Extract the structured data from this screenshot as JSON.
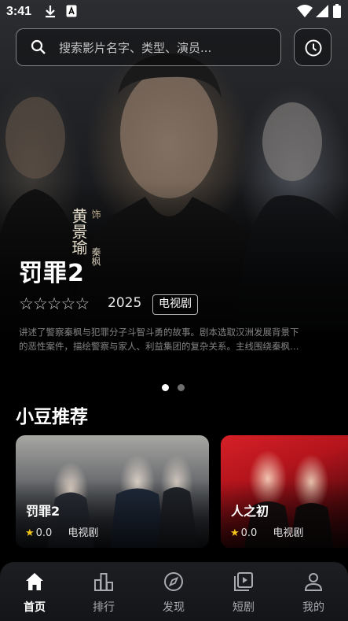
{
  "status_bar": {
    "time": "3:41"
  },
  "search": {
    "placeholder": "搜索影片名字、类型、演员..."
  },
  "hero": {
    "poster_name": "黄景瑜",
    "poster_role_suffix": "饰",
    "poster_role": "秦枫",
    "title": "罚罪2",
    "rating_stars": 0,
    "year": "2025",
    "type": "电视剧",
    "description_line1": "讲述了警察秦枫与犯罪分子斗智斗勇的故事。剧本选取汉洲发展背景下",
    "description_line2": "的恶性案件，描绘警察与家人、利益集团的复杂关系。主线围绕秦枫…",
    "carousel_count": 2,
    "carousel_active": 0
  },
  "recommend": {
    "title": "小豆推荐",
    "items": [
      {
        "title": "罚罪2",
        "score": "0.0",
        "type": "电视剧"
      },
      {
        "title": "人之初",
        "score": "0.0",
        "type": "电视剧"
      }
    ]
  },
  "nav": {
    "items": [
      {
        "label": "首页",
        "icon": "home-icon",
        "active": true
      },
      {
        "label": "排行",
        "icon": "bar-chart-icon",
        "active": false
      },
      {
        "label": "发现",
        "icon": "compass-icon",
        "active": false
      },
      {
        "label": "短剧",
        "icon": "video-library-icon",
        "active": false
      },
      {
        "label": "我的",
        "icon": "person-icon",
        "active": false
      }
    ]
  },
  "colors": {
    "accent_star": "#f5c518",
    "nav_inactive": "#a9abb0",
    "nav_active": "#ffffff"
  }
}
